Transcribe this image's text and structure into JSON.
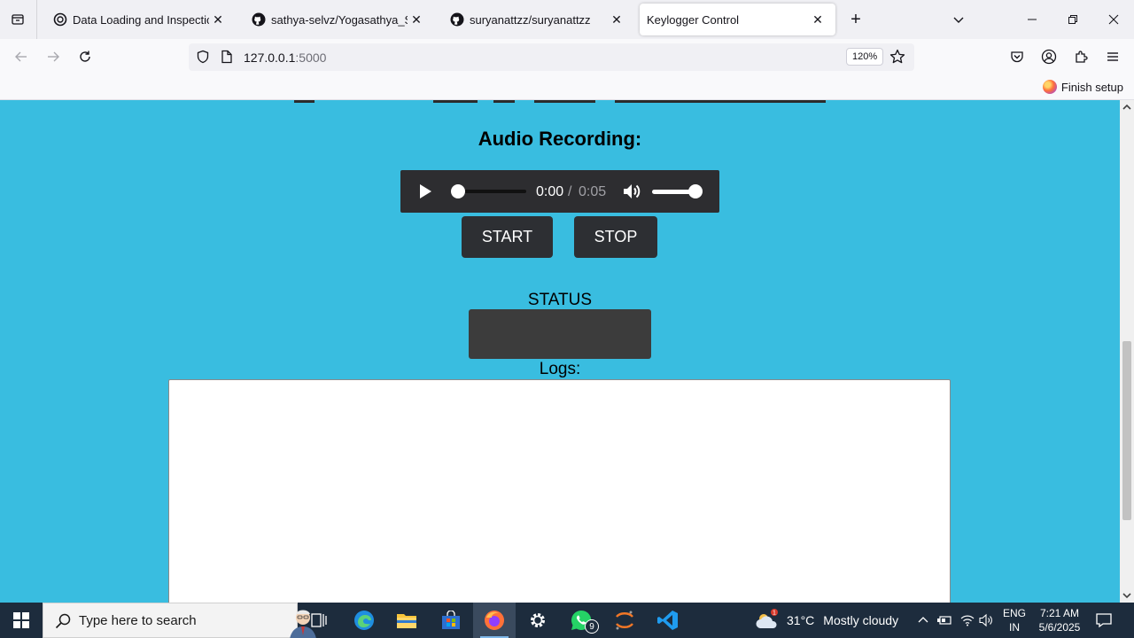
{
  "browser": {
    "tabs": [
      {
        "title": "Data Loading and Inspection",
        "favicon": "openai-icon",
        "active": false
      },
      {
        "title": "sathya-selvz/Yogasathya_S",
        "favicon": "github-icon",
        "active": false
      },
      {
        "title": "suryanattzz/suryanattzz",
        "favicon": "github-icon",
        "active": false
      },
      {
        "title": "Keylogger Control",
        "favicon": "none",
        "active": true
      }
    ],
    "address": {
      "host": "127.0.0.1",
      "port": ":5000"
    },
    "zoom": "120%",
    "bookmark_bar": {
      "finish_setup": "Finish setup"
    }
  },
  "page": {
    "background": "#39bde0",
    "audio_heading": "Audio Recording:",
    "player": {
      "current_time": "0:00",
      "separator": "/",
      "duration": "0:05",
      "progress_fraction": 0.0,
      "volume_fraction": 1.0
    },
    "buttons": {
      "start": "START",
      "stop": "STOP"
    },
    "status_label": "STATUS",
    "status_value": "",
    "logs_label": "Logs:",
    "logs_value": ""
  },
  "taskbar": {
    "search_placeholder": "Type here to search",
    "whatsapp_badge": "9",
    "weather": {
      "badge": "1",
      "temp": "31°C",
      "condition": "Mostly cloudy"
    },
    "language": {
      "line1": "ENG",
      "line2": "IN"
    },
    "clock": {
      "time": "7:21 AM",
      "date": "5/6/2025"
    }
  }
}
